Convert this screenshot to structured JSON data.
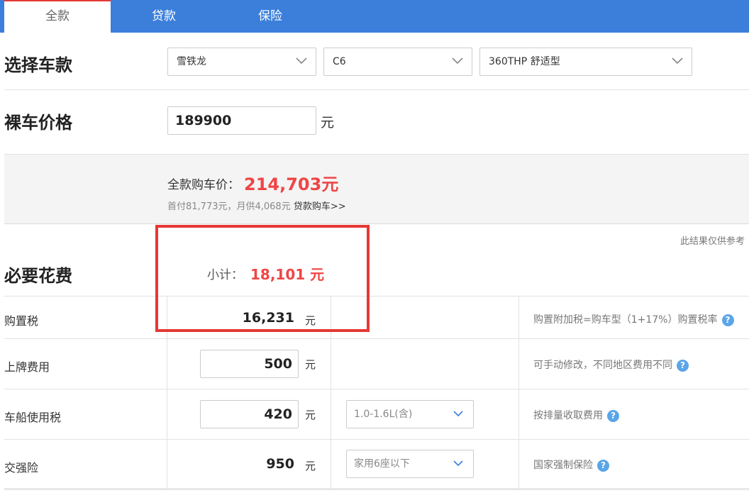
{
  "tabs": [
    {
      "label": "全款"
    },
    {
      "label": "贷款"
    },
    {
      "label": "保险"
    }
  ],
  "select_car": {
    "title": "选择车款",
    "brand": "雪铁龙",
    "model": "C6",
    "trim": "360THP 舒适型"
  },
  "bare_price": {
    "title": "裸车价格",
    "value": "189900",
    "unit": "元"
  },
  "summary": {
    "full_price_label": "全款购车价：",
    "full_price_value": "214,703元",
    "loan_text": "首付81,773元，月供4,068元",
    "loan_link": "贷款购车>>"
  },
  "note": "此结果仅供参考",
  "required": {
    "title": "必要花费",
    "subtotal_label": "小计：",
    "subtotal_value": "18,101 元",
    "rows": [
      {
        "label": "购置税",
        "value": "16,231",
        "unit": "元",
        "hint": "购置附加税=购车型（1+17%）购置税率"
      },
      {
        "label": "上牌费用",
        "value": "500",
        "unit": "元",
        "hint": "可手动修改，不同地区费用不同"
      },
      {
        "label": "车船使用税",
        "value": "420",
        "unit": "元",
        "option": "1.0-1.6L(含)",
        "hint": "按排量收取费用"
      },
      {
        "label": "交强险",
        "value": "950",
        "unit": "元",
        "option": "家用6座以下",
        "hint": "国家强制保险"
      }
    ]
  },
  "icons": {
    "chevron": "chevron-down-icon",
    "help": "question-icon"
  },
  "colors": {
    "tab_bar": "#3b7fdb",
    "accent_red": "#f04545",
    "highlight_box": "#e53935",
    "help_icon": "#5aa5e8"
  }
}
